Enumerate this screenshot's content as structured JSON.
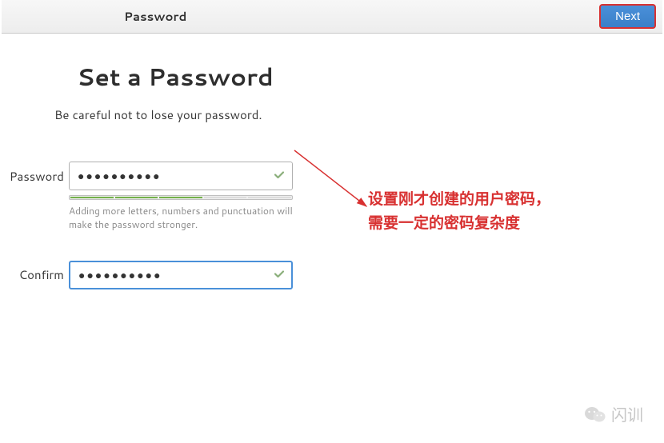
{
  "header": {
    "title": "Password",
    "next_label": "Next"
  },
  "main": {
    "title": "Set a Password",
    "subtitle": "Be careful not to lose your password."
  },
  "form": {
    "password_label": "Password",
    "password_value": "●●●●●●●●●●",
    "strength_hint": "Adding more letters, numbers and punctuation will make the password stronger.",
    "strength_filled": 3,
    "strength_total": 5,
    "confirm_label": "Confirm",
    "confirm_value": "●●●●●●●●●●"
  },
  "annotation": {
    "line1": "设置刚才创建的用户密码，",
    "line2": "需要一定的密码复杂度"
  },
  "watermark": {
    "text": "闪训"
  }
}
